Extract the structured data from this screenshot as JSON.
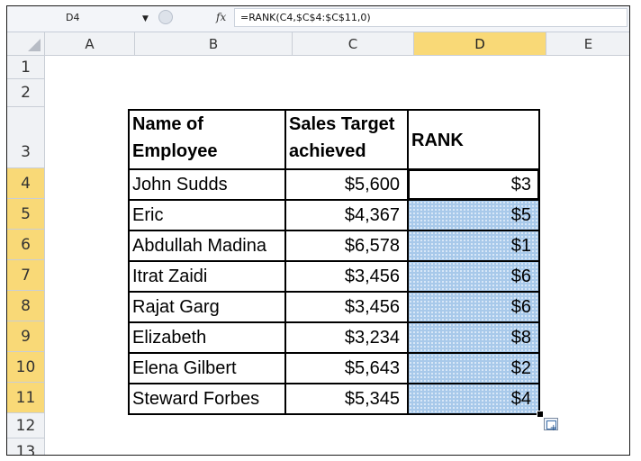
{
  "name_box": {
    "value": "D4"
  },
  "formula_bar": {
    "fx_label": "fx",
    "formula": "=RANK(C4,$C$4:$C$11,0)"
  },
  "columns": [
    "A",
    "B",
    "C",
    "D",
    "E"
  ],
  "selected_column": "D",
  "rows": [
    "1",
    "2",
    "3",
    "4",
    "5",
    "6",
    "7",
    "8",
    "9",
    "10",
    "11",
    "12",
    "13"
  ],
  "selected_rows": [
    "4",
    "5",
    "6",
    "7",
    "8",
    "9",
    "10",
    "11"
  ],
  "table": {
    "headers": {
      "name_line1": "Name of",
      "name_line2": "Employee",
      "sales_line1": "Sales Target",
      "sales_line2": "achieved",
      "rank": "RANK"
    },
    "rows": [
      {
        "name": "John Sudds",
        "sales": "$5,600",
        "rank": "$3"
      },
      {
        "name": "Eric",
        "sales": "$4,367",
        "rank": "$5"
      },
      {
        "name": "Abdullah Madina",
        "sales": "$6,578",
        "rank": "$1"
      },
      {
        "name": "Itrat Zaidi",
        "sales": "$3,456",
        "rank": "$6"
      },
      {
        "name": "Rajat Garg",
        "sales": "$3,456",
        "rank": "$6"
      },
      {
        "name": "Elizabeth",
        "sales": "$3,234",
        "rank": "$8"
      },
      {
        "name": "Elena Gilbert",
        "sales": "$5,643",
        "rank": "$2"
      },
      {
        "name": "Steward Forbes",
        "sales": "$5,345",
        "rank": "$4"
      }
    ]
  },
  "colors": {
    "selection_header": "#f9d977",
    "selection_fill": "#a8c9ea"
  },
  "icons": [
    "dropdown-arrow-icon",
    "fx-icon",
    "paste-options-icon"
  ]
}
